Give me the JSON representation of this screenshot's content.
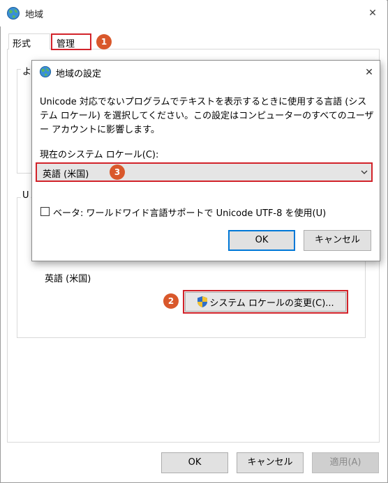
{
  "outer_window": {
    "title": "地域",
    "close_glyph": "✕",
    "tabs": [
      {
        "label": "形式"
      },
      {
        "label": "管理"
      }
    ],
    "group1_label": "よ",
    "group2_label": "U",
    "current_locale": "英語 (米国)",
    "change_locale_button": "システム ロケールの変更(C)...",
    "buttons": {
      "ok": "OK",
      "cancel": "キャンセル",
      "apply": "適用(A)"
    }
  },
  "dialog": {
    "title": "地域の設定",
    "close_glyph": "✕",
    "description": "Unicode 対応でないプログラムでテキストを表示するときに使用する言語 (システム ロケール) を選択してください。この設定はコンピューターのすべてのユーザー アカウントに影響します。",
    "locale_label": "現在のシステム ロケール(C):",
    "locale_value": "英語 (米国)",
    "beta_checkbox_label": "ベータ: ワールドワイド言語サポートで Unicode UTF-8 を使用(U)",
    "beta_checked": false,
    "buttons": {
      "ok": "OK",
      "cancel": "キャンセル"
    }
  },
  "badges": [
    "1",
    "2",
    "3"
  ],
  "colors": {
    "highlight": "#d2232a",
    "badge": "#d9582b",
    "default_button_border": "#0078d7"
  },
  "icons": [
    "globe-icon",
    "shield-icon",
    "chevron-down-icon",
    "close-icon"
  ]
}
